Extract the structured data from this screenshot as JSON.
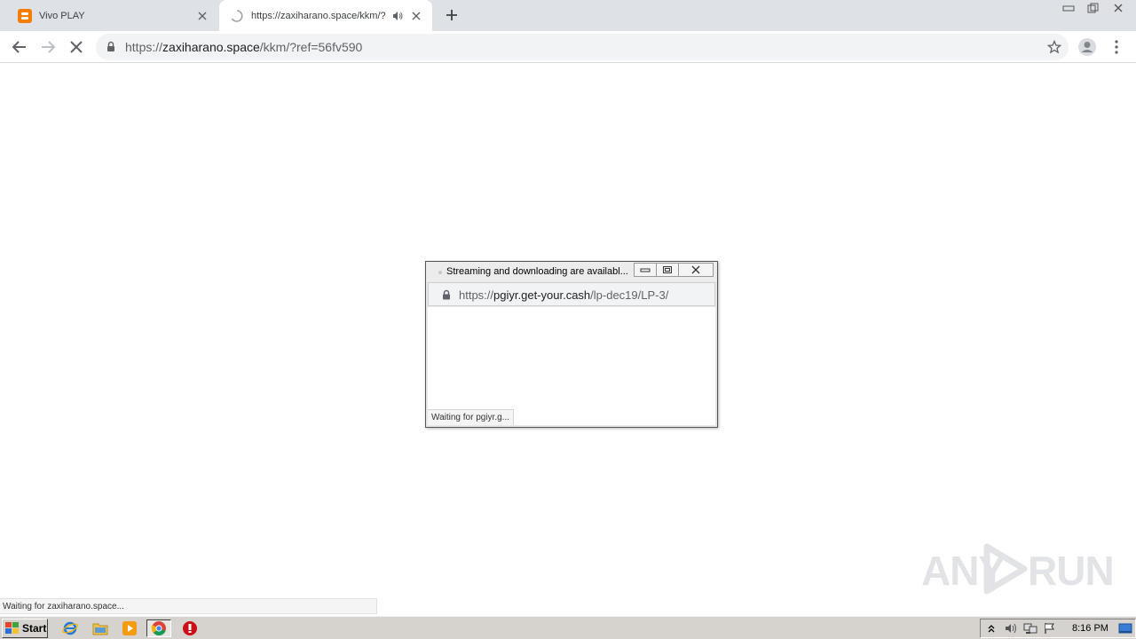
{
  "browser": {
    "tabs": [
      {
        "title": "Vivo PLAY",
        "active": false,
        "favicon": "blogger-icon"
      },
      {
        "title": "https://zaxiharano.space/kkm/?",
        "active": true,
        "favicon": "loading-spinner-icon",
        "audio": true
      }
    ],
    "address": {
      "scheme": "https://",
      "host": "zaxiharano.space",
      "path": "/kkm/?ref=56fv590"
    }
  },
  "popup": {
    "title": "Streaming and downloading are availabl...",
    "address": {
      "scheme": "https://",
      "host": "pgiyr.get-your.cash",
      "path": "/lp-dec19/LP-3/"
    },
    "status": "Waiting for pgiyr.g..."
  },
  "status_bar": "Waiting for zaxiharano.space...",
  "watermark": {
    "left": "ANY",
    "right": "RUN"
  },
  "taskbar": {
    "start_label": "Start",
    "clock": "8:16 PM"
  },
  "colors": {
    "tabstrip": "#dee1e6",
    "omnibox": "#f1f3f4",
    "taskbar": "#d6d3ce",
    "blogger": "#f57d00",
    "opera_red": "#cc0f16"
  }
}
